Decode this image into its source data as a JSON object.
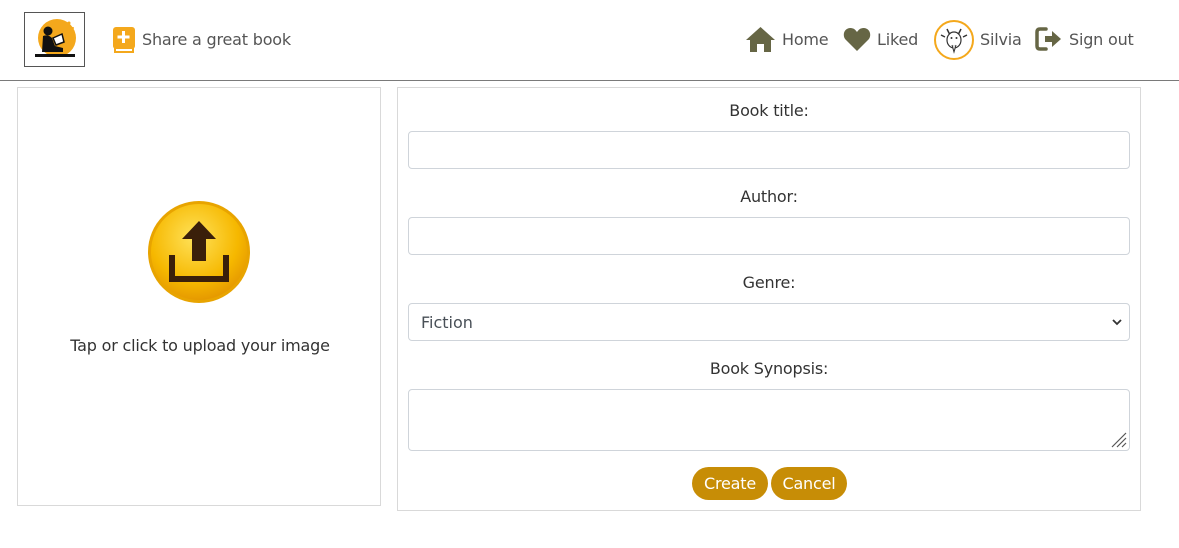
{
  "nav": {
    "share_label": "Share a great book",
    "home_label": "Home",
    "liked_label": "Liked",
    "profile_name": "Silvia",
    "signout_label": "Sign out",
    "icon_color": "#666645",
    "accent_color": "#f4a81c",
    "icons": {
      "share": "book-plus-icon",
      "home": "home-icon",
      "liked": "heart-icon",
      "signout": "sign-out-icon"
    }
  },
  "upload": {
    "prompt": "Tap or click to upload your image",
    "icon": "upload-icon"
  },
  "form": {
    "title_label": "Book title:",
    "title_value": "",
    "author_label": "Author:",
    "author_value": "",
    "genre_label": "Genre:",
    "genre_selected": "Fiction",
    "synopsis_label": "Book Synopsis:",
    "synopsis_value": "",
    "create_label": "Create",
    "cancel_label": "Cancel",
    "button_color": "#c78d06"
  }
}
